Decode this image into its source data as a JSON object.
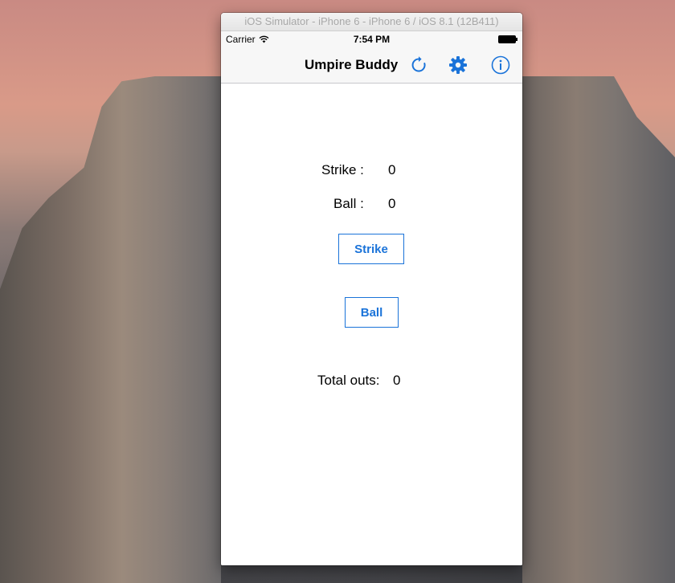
{
  "window": {
    "title": "iOS Simulator - iPhone 6 - iPhone 6 / iOS 8.1 (12B411)"
  },
  "status_bar": {
    "carrier": "Carrier",
    "time": "7:54 PM"
  },
  "nav_bar": {
    "title": "Umpire Buddy",
    "icons": [
      "refresh-icon",
      "gear-icon",
      "info-icon"
    ]
  },
  "counters": {
    "strike_label": "Strike :",
    "strike_value": "0",
    "ball_label": "Ball :",
    "ball_value": "0"
  },
  "buttons": {
    "strike": "Strike",
    "ball": "Ball"
  },
  "outs": {
    "label": "Total outs:",
    "value": "0"
  },
  "colors": {
    "tint": "#1a73d9",
    "nav_background": "#f7f7f7",
    "screen_background": "#ffffff"
  }
}
